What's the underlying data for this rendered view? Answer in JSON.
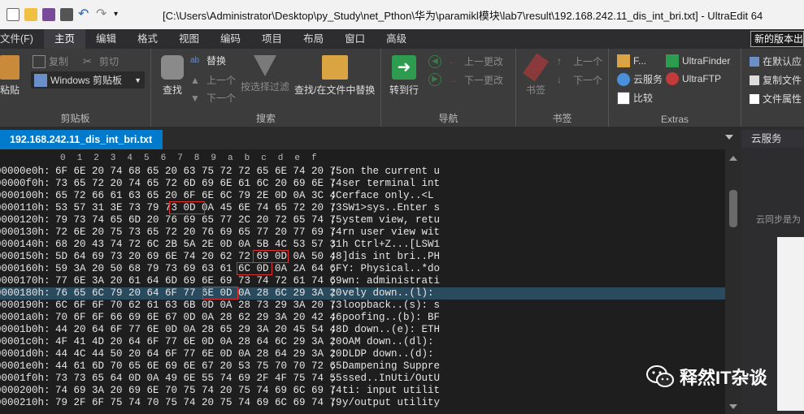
{
  "title": "[C:\\Users\\Administrator\\Desktop\\py_Study\\net_Pthon\\华为\\paramikl模块\\lab7\\result\\192.168.242.11_dis_int_bri.txt] - UltraEdit 64",
  "menu": [
    "文件(F)",
    "主页",
    "编辑",
    "格式",
    "视图",
    "编码",
    "项目",
    "布局",
    "窗口",
    "高级"
  ],
  "notice": "新的版本出现",
  "ribbon": {
    "clipboard": {
      "paste": "粘贴",
      "copy": "复制",
      "cut": "剪切",
      "windows_clipboard": "Windows 剪贴板",
      "label": "剪贴板"
    },
    "search": {
      "find": "查找",
      "replace": "替换",
      "prev": "上一个",
      "next": "下一个",
      "filter": "按选择过滤",
      "find_in_files": "查找/在文件中替换",
      "label": "搜索"
    },
    "nav": {
      "goto": "转到行",
      "prev_change": "上一更改",
      "next_change": "下一更改",
      "label": "导航"
    },
    "bookmark": {
      "bookmark": "书签",
      "prev": "上一个",
      "next": "下一个",
      "label": "书签"
    },
    "extras": {
      "f": "F...",
      "cloud": "云服务",
      "compare": "比较",
      "finder": "UltraFinder",
      "ftp": "UltraFTP",
      "label": "Extras"
    },
    "right": {
      "default": "在默认应",
      "copy_file": "复制文件",
      "file_prop": "文件属性"
    }
  },
  "file_tab": "192.168.242.11_dis_int_bri.txt",
  "ruler": [
    "0",
    "1",
    "2",
    "3",
    "4",
    "5",
    "6",
    "7",
    "8",
    "9",
    "a",
    "b",
    "c",
    "d",
    "e",
    "f"
  ],
  "rows": [
    {
      "offset": "00000e0h:",
      "hex": "6F 6E 20 74 68 65 20 63 75 72 72 65 6E 74 20 75",
      "text": "on the current u"
    },
    {
      "offset": "00000f0h:",
      "hex": "73 65 72 20 74 65 72 6D 69 6E 61 6C 20 69 6E 74",
      "text": "ser terminal int"
    },
    {
      "offset": "0000100h:",
      "hex": "65 72 66 61 63 65 20 6F 6E 6C 79 2E 0D 0A 3C 4C",
      "text": "erface only..<L"
    },
    {
      "offset": "0000110h:",
      "hex": "53 57 31 3E 73 79 73 0D 0A 45 6E 74 65 72 20 73",
      "text": "SW1>sys..Enter s"
    },
    {
      "offset": "0000120h:",
      "hex": "79 73 74 65 6D 20 76 69 65 77 2C 20 72 65 74 75",
      "text": "ystem view, retu"
    },
    {
      "offset": "0000130h:",
      "hex": "72 6E 20 75 73 65 72 20 76 69 65 77 20 77 69 74",
      "text": "rn user view wit"
    },
    {
      "offset": "0000140h:",
      "hex": "68 20 43 74 72 6C 2B 5A 2E 0D 0A 5B 4C 53 57 31",
      "text": "h Ctrl+Z...[LSW1"
    },
    {
      "offset": "0000150h:",
      "hex": "5D 64 69 73 20 69 6E 74 20 62 72 69 0D 0A 50 48",
      "text": "]dis int bri..PH"
    },
    {
      "offset": "0000160h:",
      "hex": "59 3A 20 50 68 79 73 69 63 61 6C 0D 0A 2A 64 6F",
      "text": "Y: Physical..*do"
    },
    {
      "offset": "0000170h:",
      "hex": "77 6E 3A 20 61 64 6D 69 6E 69 73 74 72 61 74 69",
      "text": "wn: administrati"
    },
    {
      "offset": "0000180h:",
      "hex": "76 65 6C 79 20 64 6F 77 6E 0D 0A 28 6C 29 3A 20",
      "text": "vely down..(l): "
    },
    {
      "offset": "0000190h:",
      "hex": "6C 6F 6F 70 62 61 63 6B 0D 0A 28 73 29 3A 20 73",
      "text": "loopback..(s): s"
    },
    {
      "offset": "00001a0h:",
      "hex": "70 6F 6F 66 69 6E 67 0D 0A 28 62 29 3A 20 42 46",
      "text": "poofing..(b): BF"
    },
    {
      "offset": "00001b0h:",
      "hex": "44 20 64 6F 77 6E 0D 0A 28 65 29 3A 20 45 54 48",
      "text": "D down..(e): ETH"
    },
    {
      "offset": "00001c0h:",
      "hex": "4F 41 4D 20 64 6F 77 6E 0D 0A 28 64 6C 29 3A 20",
      "text": "OAM down..(dl): "
    },
    {
      "offset": "00001d0h:",
      "hex": "44 4C 44 50 20 64 6F 77 6E 0D 0A 28 64 29 3A 20",
      "text": "DLDP down..(d): "
    },
    {
      "offset": "00001e0h:",
      "hex": "44 61 6D 70 65 6E 69 6E 67 20 53 75 70 70 72 65",
      "text": "Dampening Suppre"
    },
    {
      "offset": "00001f0h:",
      "hex": "73 73 65 64 0D 0A 49 6E 55 74 69 2F 4F 75 74 55",
      "text": "ssed..InUti/OutU"
    },
    {
      "offset": "0000200h:",
      "hex": "74 69 3A 20 69 6E 70 75 74 20 75 74 69 6C 69 74",
      "text": "ti: input utilit"
    },
    {
      "offset": "0000210h:",
      "hex": "79 2F 6F 75 74 70 75 74 20 75 74 69 6C 69 74 79",
      "text": "y/output utility"
    }
  ],
  "cloud_panel": {
    "header": "云服务",
    "sub": "云同步是为"
  },
  "watermark": "释然IT杂谈"
}
